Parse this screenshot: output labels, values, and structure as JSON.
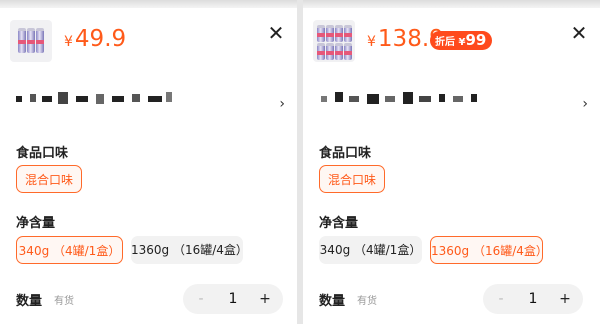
{
  "left_panel": {
    "currency": "¥",
    "price": "49.9",
    "close_icon": "close-icon",
    "flavor_title": "食品口味",
    "flavor_option": "混合口味",
    "size_title": "净含量",
    "size_options": [
      "340g （4罐/1盒）",
      "1360g （16罐/4盒）"
    ],
    "selected_size_index": 0,
    "qty_label": "数量",
    "stock_label": "有货",
    "qty_minus": "-",
    "qty_value": "1",
    "qty_plus": "+"
  },
  "right_panel": {
    "currency": "¥",
    "price": "138.9",
    "discount_prefix": "折后",
    "discount_currency": "¥",
    "discount_value": "99",
    "close_icon": "close-icon",
    "flavor_title": "食品口味",
    "flavor_option": "混合口味",
    "size_title": "净含量",
    "size_options": [
      "340g （4罐/1盒）",
      "1360g （16罐/4盒）"
    ],
    "selected_size_index": 1,
    "qty_label": "数量",
    "stock_label": "有货",
    "qty_minus": "-",
    "qty_value": "1",
    "qty_plus": "+"
  },
  "colors": {
    "accent": "#ff5a1a",
    "discount_badge": "#ff4a1c",
    "chip_unselected": "#f2f2f2"
  }
}
